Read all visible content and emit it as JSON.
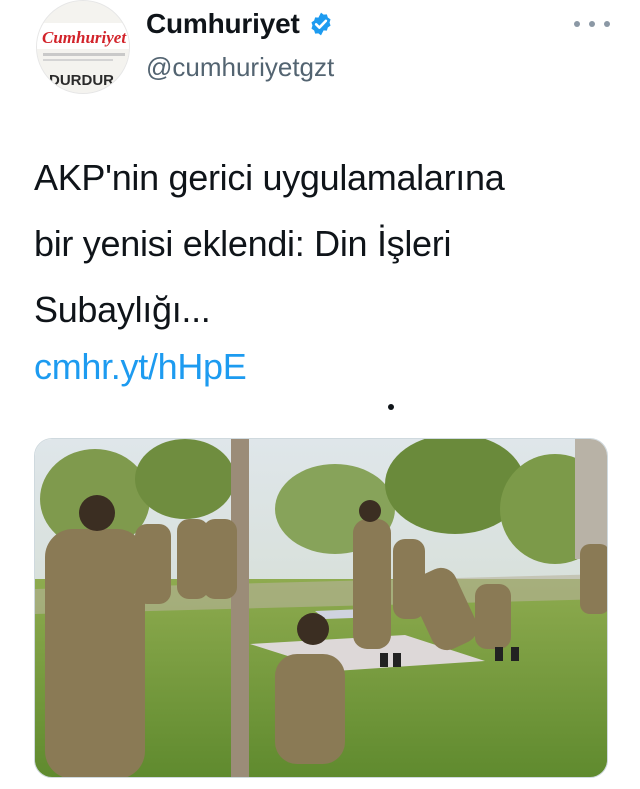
{
  "account": {
    "display_name": "Cumhuriyet",
    "handle": "@cumhuriyetgzt",
    "verified": true,
    "avatar": {
      "logo_text": "Cumhuriyet",
      "headline_text": "DURDUR"
    }
  },
  "icons": {
    "verified": "verified-badge-icon",
    "more": "more-horizontal-icon"
  },
  "tweet": {
    "text_lines": [
      "AKP'nin gerici uygulamalarına",
      "bir yenisi eklendi: Din İşleri",
      "Subaylığı..."
    ],
    "link": "cmhr.yt/hHpE"
  },
  "media": {
    "description_type": "photo"
  },
  "colors": {
    "link": "#1d9bf0",
    "verified": "#1d9bf0",
    "text": "#0f1419",
    "secondary": "#536471",
    "avatar_logo": "#d2232a"
  }
}
